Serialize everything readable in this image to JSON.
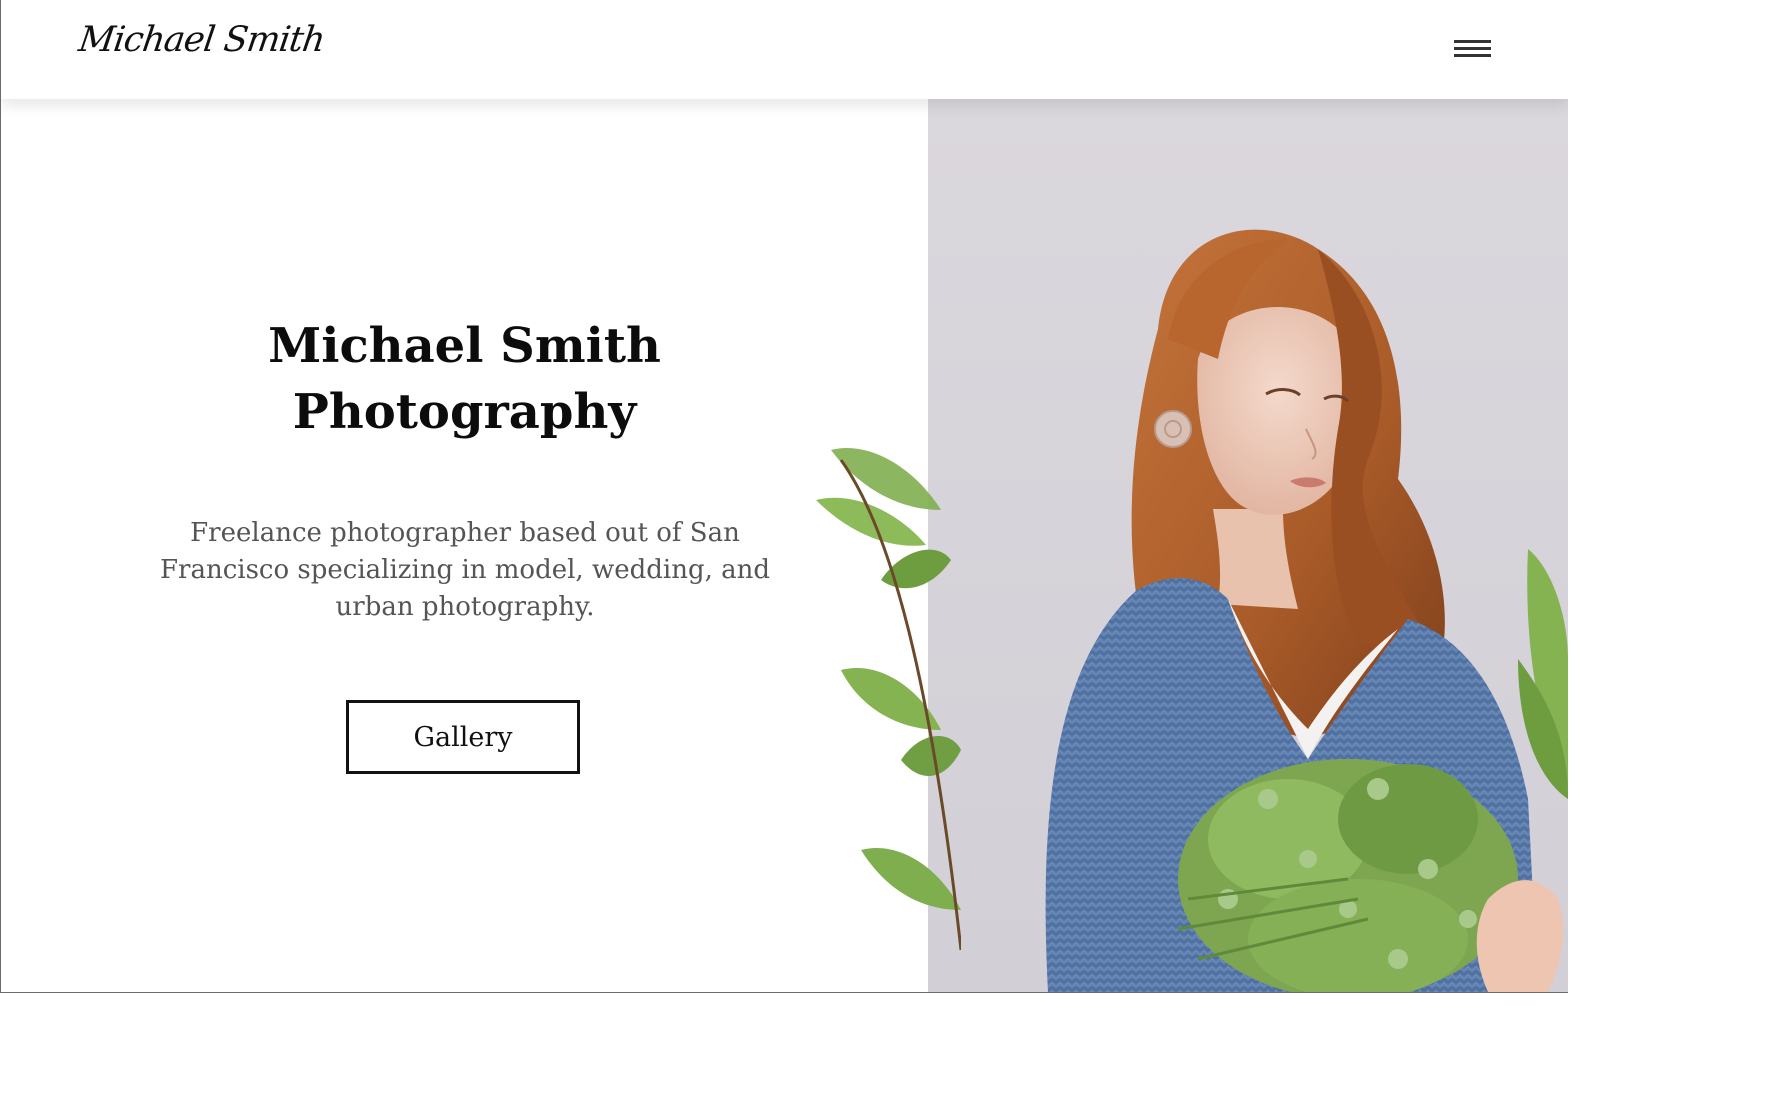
{
  "header": {
    "logo_text": "Michael Smith",
    "menu_icon": "hamburger-menu-icon"
  },
  "hero": {
    "title_line1": "Michael Smith",
    "title_line2": "Photography",
    "description": "Freelance photographer based out of San Francisco specializing in model, wedding, and urban photography.",
    "button_label": "Gallery"
  },
  "colors": {
    "text_dark": "#0c0c0c",
    "text_muted": "#555555",
    "photo_background": "#dcd9de",
    "sweater_blue": "#5a7aa8",
    "hair_auburn": "#b8662e",
    "foliage_green": "#7aa84a"
  }
}
